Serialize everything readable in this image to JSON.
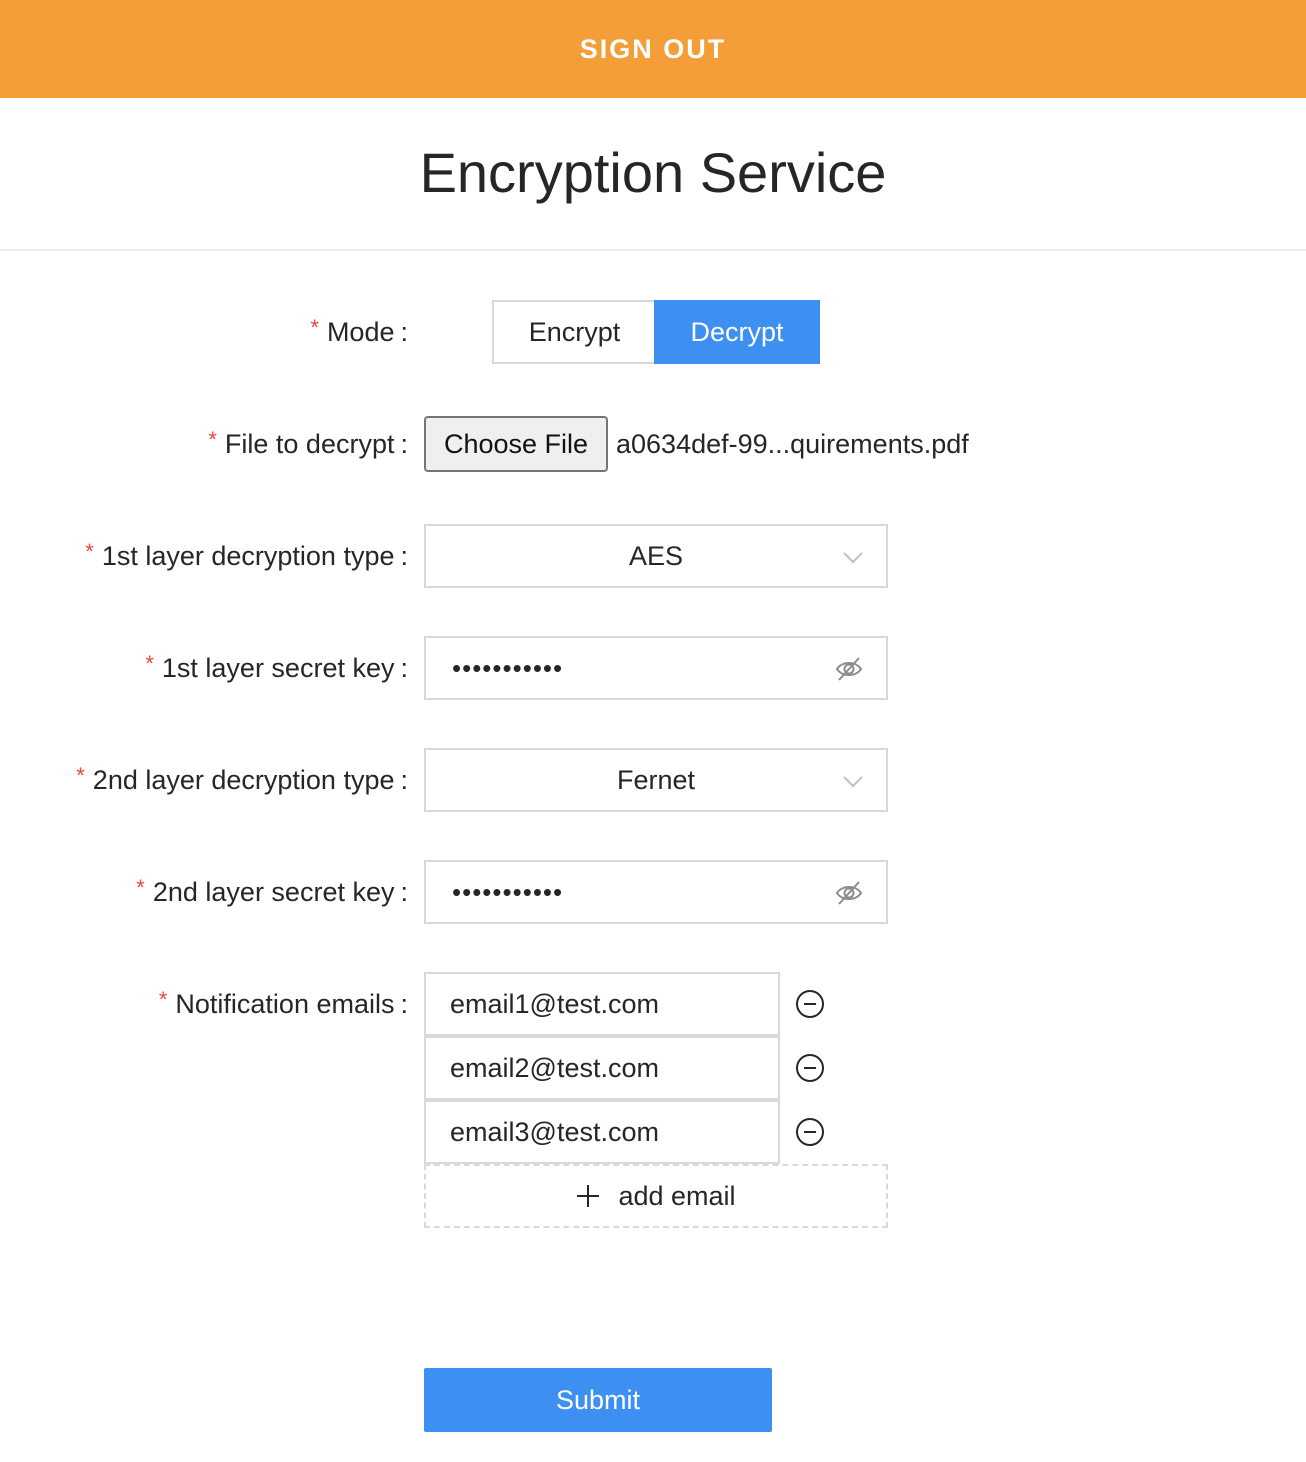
{
  "header": {
    "sign_out_label": "SIGN OUT"
  },
  "page": {
    "title": "Encryption Service"
  },
  "form": {
    "mode": {
      "label": "Mode",
      "options": [
        "Encrypt",
        "Decrypt"
      ],
      "selected": "Decrypt"
    },
    "file": {
      "label": "File to decrypt",
      "button_label": "Choose File",
      "file_name": "a0634def-99...quirements.pdf"
    },
    "layer1_type": {
      "label": "1st layer decryption type",
      "value": "AES"
    },
    "layer1_key": {
      "label": "1st layer secret key",
      "masked_value": "•••••••••••"
    },
    "layer2_type": {
      "label": "2nd layer decryption type",
      "value": "Fernet"
    },
    "layer2_key": {
      "label": "2nd layer secret key",
      "masked_value": "•••••••••••"
    },
    "emails": {
      "label": "Notification emails",
      "items": [
        "email1@test.com",
        "email2@test.com",
        "email3@test.com"
      ],
      "add_label": "add email"
    },
    "required_mark": "*",
    "colon": ":",
    "submit_label": "Submit"
  },
  "colors": {
    "header": "#f39e38",
    "primary": "#3d8ff2",
    "required": "#e8493f"
  },
  "icons": {
    "select": "chevron-down-icon",
    "password": "eye-invisible-icon",
    "remove": "minus-circle-icon",
    "add": "plus-icon"
  }
}
